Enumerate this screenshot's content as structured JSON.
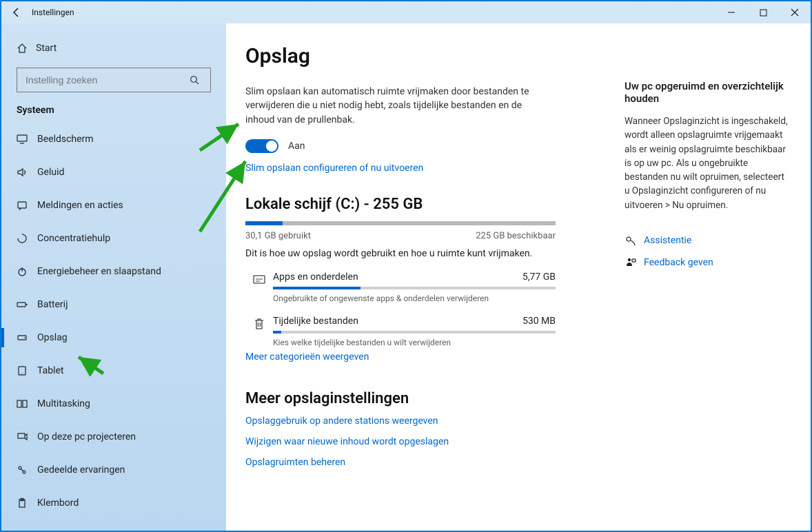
{
  "window": {
    "title": "Instellingen"
  },
  "sidebar": {
    "start_label": "Start",
    "search_placeholder": "Instelling zoeken",
    "section_title": "Systeem",
    "items": [
      {
        "label": "Beeldscherm",
        "icon": "display"
      },
      {
        "label": "Geluid",
        "icon": "sound"
      },
      {
        "label": "Meldingen en acties",
        "icon": "notifications"
      },
      {
        "label": "Concentratiehulp",
        "icon": "focus"
      },
      {
        "label": "Energiebeheer en slaapstand",
        "icon": "power"
      },
      {
        "label": "Batterij",
        "icon": "battery"
      },
      {
        "label": "Opslag",
        "icon": "storage",
        "active": true
      },
      {
        "label": "Tablet",
        "icon": "tablet"
      },
      {
        "label": "Multitasking",
        "icon": "multitask"
      },
      {
        "label": "Op deze pc projecteren",
        "icon": "project"
      },
      {
        "label": "Gedeelde ervaringen",
        "icon": "shared"
      },
      {
        "label": "Klembord",
        "icon": "clipboard"
      }
    ]
  },
  "main": {
    "title": "Opslag",
    "description": "Slim opslaan kan automatisch ruimte vrijmaken door bestanden te verwijderen die u niet nodig hebt, zoals tijdelijke bestanden en de inhoud van de prullenbak.",
    "toggle_state_label": "Aan",
    "configure_link": "Slim opslaan configureren of nu uitvoeren",
    "disk_heading": "Lokale schijf (C:) - 255 GB",
    "usage": {
      "used_label": "30,1 GB gebruikt",
      "free_label": "225 GB beschikbaar",
      "used_fraction": 0.12
    },
    "usage_hint": "Dit is hoe uw opslag wordt gebruikt en hoe u ruimte kunt vrijmaken.",
    "categories": [
      {
        "icon": "apps",
        "title": "Apps en onderdelen",
        "size": "5,77 GB",
        "fraction": 0.31,
        "sub": "Ongebruikte of ongewenste apps & onderdelen verwijderen"
      },
      {
        "icon": "trash",
        "title": "Tijdelijke bestanden",
        "size": "530 MB",
        "fraction": 0.03,
        "sub": "Kies welke tijdelijke bestanden u wilt verwijderen"
      }
    ],
    "show_more": "Meer categorieën weergeven",
    "more_settings_heading": "Meer opslaginstellingen",
    "more_links": [
      "Opslaggebruik op andere stations weergeven",
      "Wijzigen waar nieuwe inhoud wordt opgeslagen",
      "Opslagruimten beheren"
    ]
  },
  "aside": {
    "heading": "Uw pc opgeruimd en overzichtelijk houden",
    "body": "Wanneer Opslaginzicht is ingeschakeld, wordt alleen opslagruimte vrijgemaakt als er weinig opslagruimte beschikbaar is op uw pc. Als u ongebruikte bestanden nu wilt opruimen, selecteert u Opslaginzicht configureren of nu uitvoeren > Nu opruimen.",
    "links": [
      {
        "label": "Assistentie",
        "icon": "help"
      },
      {
        "label": "Feedback geven",
        "icon": "feedback"
      }
    ]
  }
}
